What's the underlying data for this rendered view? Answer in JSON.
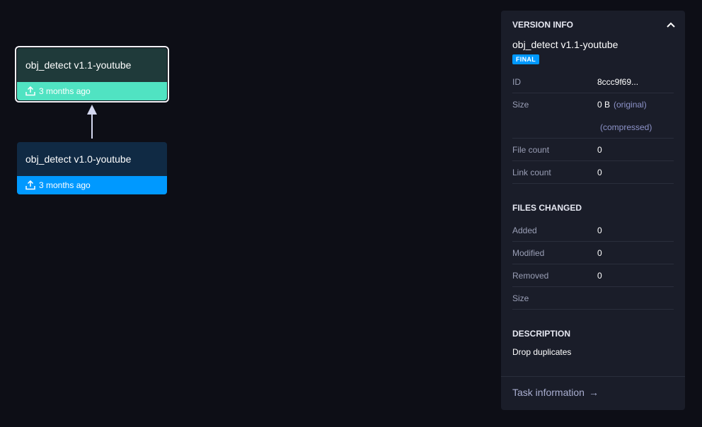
{
  "nodes": [
    {
      "title": "obj_detect v1.1-youtube",
      "time": "3 months ago",
      "color": "#50e3c2",
      "selected": true
    },
    {
      "title": "obj_detect v1.0-youtube",
      "time": "3 months ago",
      "color": "#0099ff",
      "selected": false
    }
  ],
  "panel": {
    "heading": "VERSION INFO",
    "version_name": "obj_detect v1.1-youtube",
    "badge": "FINAL",
    "info": {
      "id_label": "ID",
      "id_value": "8ccc9f69...",
      "size_label": "Size",
      "size_value": "0 B",
      "size_original": "(original)",
      "size_compressed": "(compressed)",
      "file_count_label": "File count",
      "file_count_value": "0",
      "link_count_label": "Link count",
      "link_count_value": "0"
    },
    "files_changed": {
      "heading": "FILES CHANGED",
      "added_label": "Added",
      "added_value": "0",
      "modified_label": "Modified",
      "modified_value": "0",
      "removed_label": "Removed",
      "removed_value": "0",
      "size_label": "Size",
      "size_value": ""
    },
    "description": {
      "heading": "DESCRIPTION",
      "text": "Drop duplicates"
    },
    "task_link": "Task information",
    "task_arrow": "→"
  },
  "colors": {
    "background": "#0d0e16",
    "panel": "#1a1d29",
    "accent_teal": "#50e3c2",
    "accent_blue": "#0099ff"
  }
}
